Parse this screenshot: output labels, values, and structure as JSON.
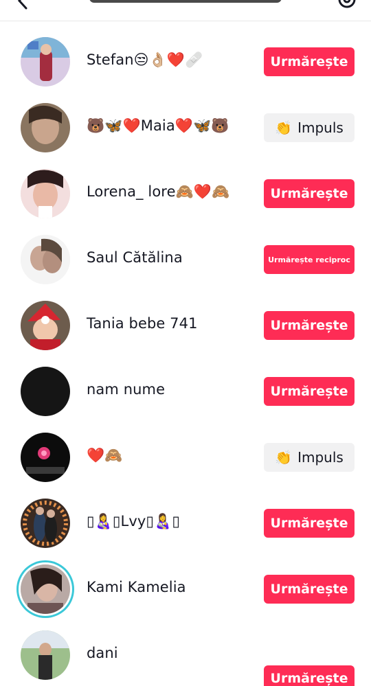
{
  "header": {
    "back_icon": "chevron-left-icon",
    "settings_icon": "gear-icon"
  },
  "colors": {
    "follow": "#fe2c55",
    "impuls_bg": "#f1f1f2",
    "ring": "#3bc8d8"
  },
  "users": [
    {
      "name": "Stefan😒👌🏼❤️🩹",
      "button": "Urmărește"
    },
    {
      "name": "🐻🦋❤️Maia❤️🦋🐻",
      "button": "Impuls",
      "button_icon": "👏"
    },
    {
      "name": "Lorena_ lore🙈❤️🙈",
      "button": "Urmărește"
    },
    {
      "name": "Saul Cătălina",
      "button": "Urmărește reciproc"
    },
    {
      "name": "Tania bebe 741",
      "button": "Urmărește"
    },
    {
      "name": "nam nume",
      "button": "Urmărește"
    },
    {
      "name": "❤️🙈",
      "button": "Impuls",
      "button_icon": "👏"
    },
    {
      "name": "▯👩‍🍼▯Lvy▯👩‍🍼▯",
      "button": "Urmărește"
    },
    {
      "name": "Kami Kamelia",
      "button": "Urmărește"
    },
    {
      "name": "dani",
      "button": "Urmărește"
    }
  ]
}
